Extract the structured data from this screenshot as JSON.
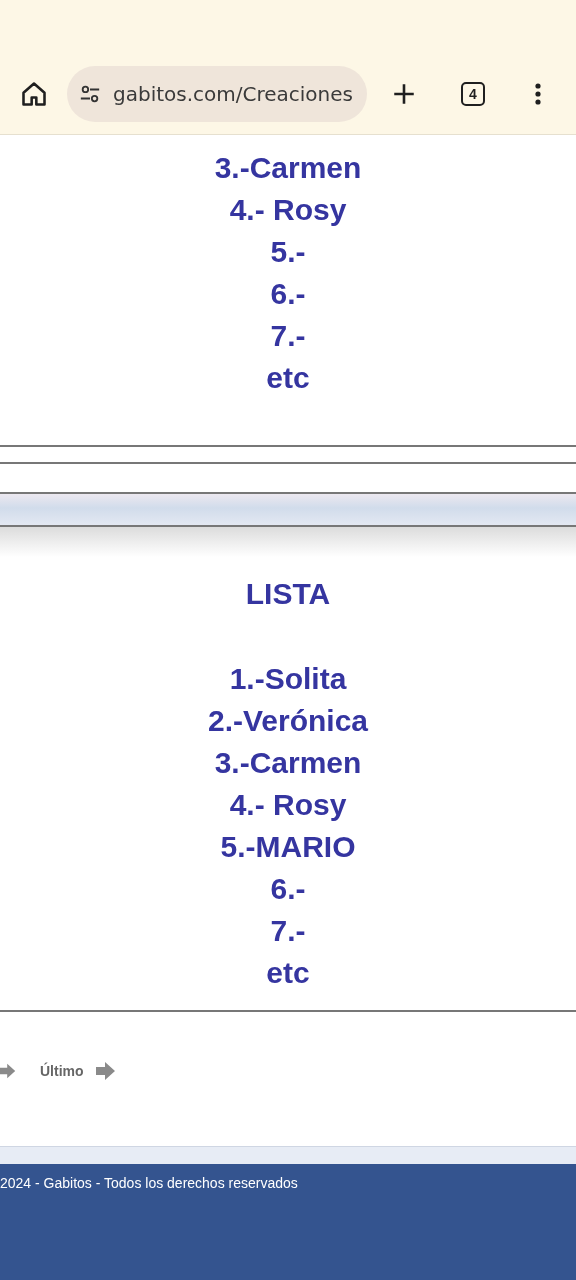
{
  "browser": {
    "url": "gabitos.com/Creaciones",
    "tab_count": "4"
  },
  "posts": [
    {
      "lines": [
        "3.-Carmen",
        "4.- Rosy",
        "5.-",
        "6.-",
        "7.-",
        "etc"
      ]
    },
    {
      "heading": "LISTA",
      "lines": [
        "1.-Solita",
        "2.-Verónica",
        "3.-Carmen",
        "4.- Rosy",
        "5.-MARIO",
        "6.-",
        "7.-",
        "etc"
      ]
    }
  ],
  "pagination": {
    "last_label": "Último"
  },
  "footer": {
    "text": "2024 - Gabitos - Todos los derechos reservados"
  }
}
